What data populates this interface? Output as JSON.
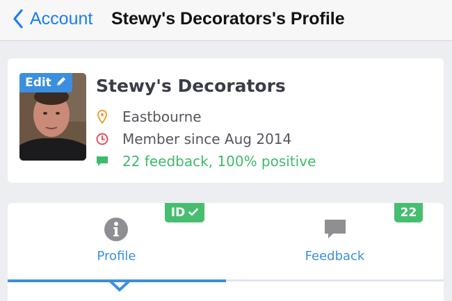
{
  "nav": {
    "back_label": "Account",
    "title": "Stewy's Decorators's Profile"
  },
  "profile": {
    "edit_label": "Edit",
    "name": "Stewy's Decorators",
    "location": "Eastbourne",
    "member_since": "Member since Aug 2014",
    "feedback_summary": "22 feedback, 100% positive"
  },
  "tabs": {
    "profile_label": "Profile",
    "feedback_label": "Feedback",
    "id_badge": "ID",
    "feedback_count": "22",
    "active": "Profile"
  },
  "colors": {
    "accent_blue": "#3b8fde",
    "ios_link_blue": "#1a7cf4",
    "success_green": "#47bd6f",
    "location_orange": "#f0a030",
    "clock_red": "#e8505b"
  },
  "icons": {
    "back": "chevron-left-icon",
    "edit": "pencil-icon",
    "location": "map-pin-icon",
    "member": "clock-icon",
    "feedback": "speech-bubble-icon",
    "profile_tab": "info-circle-icon",
    "feedback_tab": "chat-bubble-icon",
    "id_verified": "checkmark-icon"
  }
}
